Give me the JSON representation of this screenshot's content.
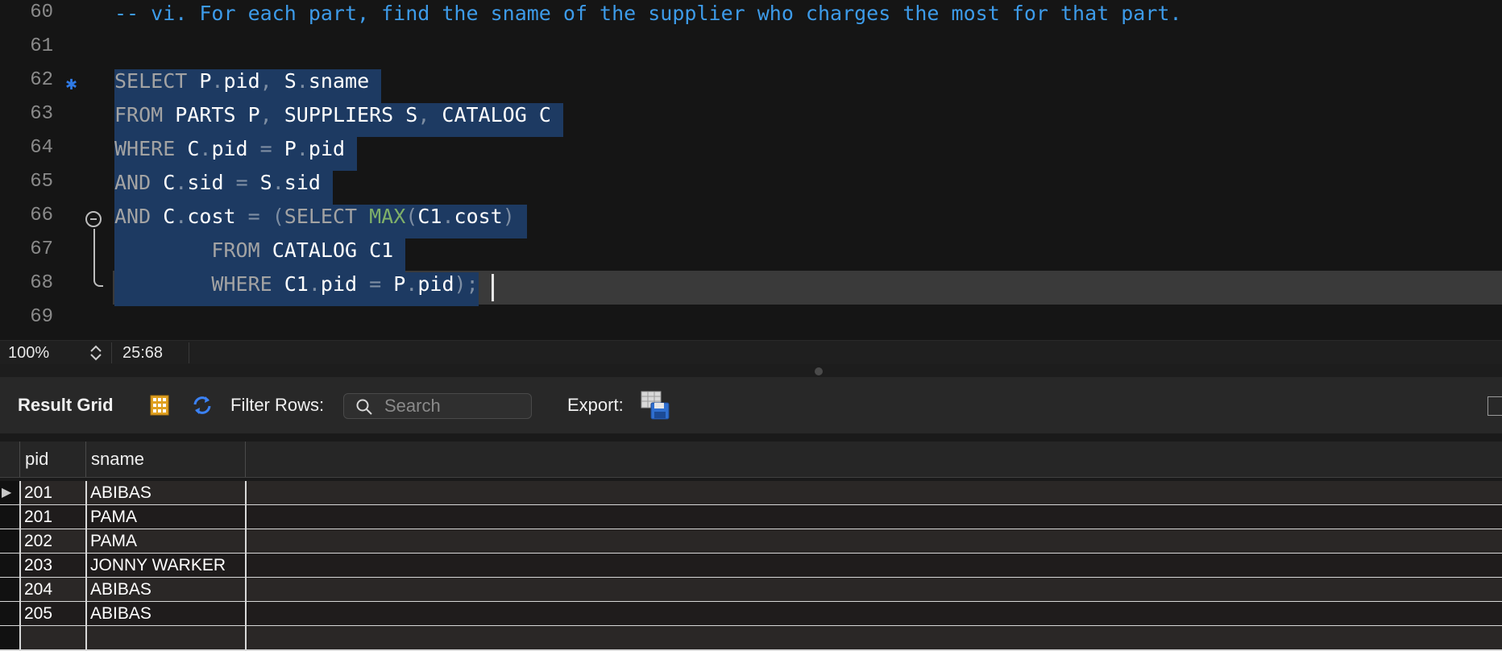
{
  "editor": {
    "lines": [
      {
        "num": "60",
        "tokens": [
          {
            "t": "-- vi. For each part, find the sname of the supplier who charges the most for that part.",
            "c": "cm"
          }
        ]
      },
      {
        "num": "61",
        "tokens": []
      },
      {
        "num": "62",
        "tokens": [
          {
            "t": "SELECT ",
            "c": "kw"
          },
          {
            "t": "P",
            "c": "id"
          },
          {
            "t": ".",
            "c": "pn"
          },
          {
            "t": "pid",
            "c": "id"
          },
          {
            "t": ", ",
            "c": "pn"
          },
          {
            "t": "S",
            "c": "id"
          },
          {
            "t": ".",
            "c": "pn"
          },
          {
            "t": "sname ",
            "c": "id"
          }
        ]
      },
      {
        "num": "63",
        "tokens": [
          {
            "t": "FROM ",
            "c": "kw"
          },
          {
            "t": "PARTS P",
            "c": "id"
          },
          {
            "t": ", ",
            "c": "pn"
          },
          {
            "t": "SUPPLIERS S",
            "c": "id"
          },
          {
            "t": ", ",
            "c": "pn"
          },
          {
            "t": "CATALOG C ",
            "c": "id"
          }
        ]
      },
      {
        "num": "64",
        "tokens": [
          {
            "t": "WHERE ",
            "c": "kw"
          },
          {
            "t": "C",
            "c": "id"
          },
          {
            "t": ".",
            "c": "pn"
          },
          {
            "t": "pid ",
            "c": "id"
          },
          {
            "t": "= ",
            "c": "pn"
          },
          {
            "t": "P",
            "c": "id"
          },
          {
            "t": ".",
            "c": "pn"
          },
          {
            "t": "pid ",
            "c": "id"
          }
        ]
      },
      {
        "num": "65",
        "tokens": [
          {
            "t": "AND ",
            "c": "kw"
          },
          {
            "t": "C",
            "c": "id"
          },
          {
            "t": ".",
            "c": "pn"
          },
          {
            "t": "sid ",
            "c": "id"
          },
          {
            "t": "= ",
            "c": "pn"
          },
          {
            "t": "S",
            "c": "id"
          },
          {
            "t": ".",
            "c": "pn"
          },
          {
            "t": "sid ",
            "c": "id"
          }
        ]
      },
      {
        "num": "66",
        "tokens": [
          {
            "t": "AND ",
            "c": "kw"
          },
          {
            "t": "C",
            "c": "id"
          },
          {
            "t": ".",
            "c": "pn"
          },
          {
            "t": "cost ",
            "c": "id"
          },
          {
            "t": "= (",
            "c": "pn"
          },
          {
            "t": "SELECT ",
            "c": "kw"
          },
          {
            "t": "MAX",
            "c": "fn"
          },
          {
            "t": "(",
            "c": "pn"
          },
          {
            "t": "C1",
            "c": "id"
          },
          {
            "t": ".",
            "c": "pn"
          },
          {
            "t": "cost",
            "c": "id"
          },
          {
            "t": ") ",
            "c": "pn"
          }
        ]
      },
      {
        "num": "67",
        "tokens": [
          {
            "t": "        ",
            "c": "id"
          },
          {
            "t": "FROM ",
            "c": "kw"
          },
          {
            "t": "CATALOG C1 ",
            "c": "id"
          }
        ]
      },
      {
        "num": "68",
        "tokens": [
          {
            "t": "        ",
            "c": "id"
          },
          {
            "t": "WHERE ",
            "c": "kw"
          },
          {
            "t": "C1",
            "c": "id"
          },
          {
            "t": ".",
            "c": "pn"
          },
          {
            "t": "pid ",
            "c": "id"
          },
          {
            "t": "= ",
            "c": "pn"
          },
          {
            "t": "P",
            "c": "id"
          },
          {
            "t": ".",
            "c": "pn"
          },
          {
            "t": "pid",
            "c": "id"
          },
          {
            "t": ");",
            "c": "pn"
          }
        ]
      },
      {
        "num": "69",
        "tokens": []
      }
    ],
    "selected_lines": [
      "62",
      "63",
      "64",
      "65",
      "66",
      "67",
      "68"
    ]
  },
  "status": {
    "zoom": "100%",
    "cursor": "25:68"
  },
  "result": {
    "title": "Result Grid",
    "filter_label": "Filter Rows:",
    "search_placeholder": "Search",
    "export_label": "Export:",
    "columns": [
      "pid",
      "sname"
    ],
    "rows": [
      {
        "pid": "201",
        "sname": "ABIBAS"
      },
      {
        "pid": "201",
        "sname": "PAMA"
      },
      {
        "pid": "202",
        "sname": "PAMA"
      },
      {
        "pid": "203",
        "sname": "JONNY WARKER"
      },
      {
        "pid": "204",
        "sname": "ABIBAS"
      },
      {
        "pid": "205",
        "sname": "ABIBAS"
      },
      {
        "pid": "",
        "sname": ""
      }
    ],
    "current_row_marker": "▶"
  },
  "colors": {
    "selection": "#1d3a62",
    "comment": "#3d9be9",
    "keyword": "#a3a3a3",
    "function": "#7fb069",
    "breakpoint": "#2f7ae5"
  }
}
